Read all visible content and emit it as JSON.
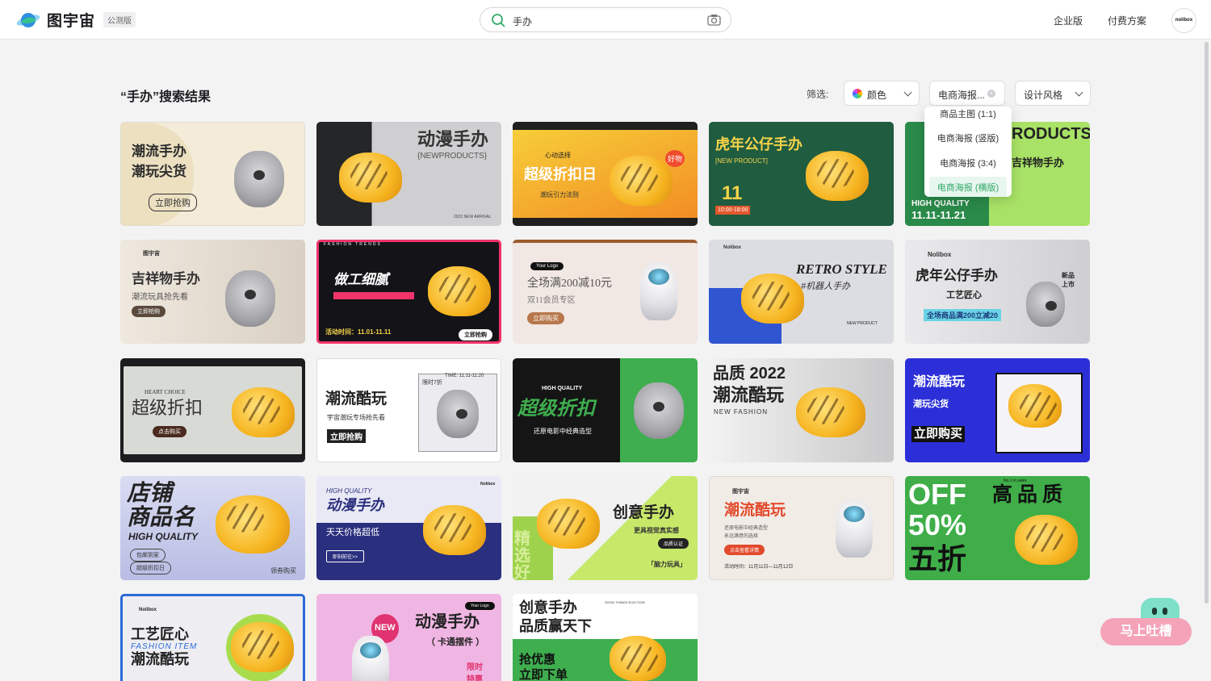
{
  "header": {
    "logo_text": "图宇宙",
    "beta_badge": "公测版",
    "search_value": "手办",
    "nav_enterprise": "企业版",
    "nav_pricing": "付费方案",
    "avatar_text": "nolibox"
  },
  "toolbar": {
    "results_title": "“手办”搜索结果",
    "filter_label": "筛选:",
    "color_filter": "颜色",
    "size_filter": "电商海报...",
    "style_filter": "设计风格"
  },
  "size_dropdown": {
    "options": [
      "商品主图 (1:1)",
      "电商海报 (竖版)",
      "电商海报 (3:4)",
      "电商海报 (横版)"
    ]
  },
  "cards": [
    {
      "title": "潮流手办",
      "title2": "潮玩尖货",
      "button": "立即抢购"
    },
    {
      "title": "动漫手办",
      "sub": "{NEWPRODUCTS}",
      "sub2": "2022 NEW ARRIVAL"
    },
    {
      "title": "超级折扣日",
      "sub": "潮玩引力法则",
      "badge": "心动选择",
      "chip": "好物"
    },
    {
      "title": "虎年公仔手办",
      "sub": "[NEW PRODUCT]",
      "num": "11",
      "time": "10:00-18:00"
    },
    {
      "title": "RODUCTS",
      "sub": "吉祥物手办",
      "sub2": "HIGH QUALITY",
      "sub3": "11.11-11.21"
    },
    {
      "title": "吉祥物手办",
      "sub": "潮流玩具抢先看",
      "button": "立即抢购",
      "brand": "图宇宙"
    },
    {
      "title": "做工细腻",
      "sub": "活动时间：11.01-11.11",
      "button": "立即抢购",
      "top": "FASHION TRENDS"
    },
    {
      "title": "全场满200减10元",
      "sub": "双11会员专区",
      "button": "立即购买",
      "logo": "Your Logo"
    },
    {
      "title": "RETRO STYLE",
      "sub": "#机器人手办",
      "sub2": "NEW PRODUCT",
      "brand": "Nolibox"
    },
    {
      "title": "虎年公仔手办",
      "sub": "工艺匠心",
      "sub2": "全场商品满200立减20",
      "tag": "新品上市",
      "brand": "Nolibox"
    },
    {
      "title": "超级折扣",
      "sub": "HEART CHOICE",
      "button": "点击购买"
    },
    {
      "title": "潮流酷玩",
      "sub": "宇宙潮玩专场抢先看",
      "button": "立即抢购",
      "tag": "限时7折",
      "time": "TIME: 11.11-11.20"
    },
    {
      "title": "超级折扣",
      "sub": "HIGH QUALITY",
      "sub2": "还原电影中经典造型"
    },
    {
      "title": "品质 2022",
      "title2": "潮流酷玩",
      "sub": "NEW FASHION"
    },
    {
      "title": "潮流酷玩",
      "sub": "潮玩尖货",
      "button": "立即购买"
    },
    {
      "title": "店铺",
      "title2": "商品名",
      "sub": "HIGH QUALITY",
      "b1": "包邮到家",
      "b2": "超级折扣日",
      "tag": "领券购买"
    },
    {
      "title": "动漫手办",
      "sub": "HIGH QUALITY",
      "sub2": "天天价格超低",
      "button": "即刻前往>>",
      "brand": "Nolibox"
    },
    {
      "title": "创意手办",
      "sub": "更具视觉真实感",
      "button": "品质认证",
      "sub2": "「脑力玩具」",
      "side": "精选好物"
    },
    {
      "title": "潮流酷玩",
      "sub": "还原电影中经典造型",
      "sub2": "永远满意的选择",
      "button": "点击查看详情",
      "time": "活动时间：11月11日—11月12日",
      "brand": "图宇宙"
    },
    {
      "title": "OFF",
      "big": "50%",
      "title2": "五折",
      "side": "高品质",
      "top": "No.1 in sales"
    },
    {
      "title": "工艺匠心",
      "sub": "FASHION ITEM",
      "title2": "潮流酷玩",
      "brand": "Nolibox"
    },
    {
      "title": "动漫手办",
      "sub": "（ 卡通摆件 ）",
      "chip": "NEW",
      "tag": "限时特惠",
      "logo": "Your Logo"
    },
    {
      "title": "创意手办",
      "title2": "品质赢天下",
      "sub": "抢优惠",
      "sub2": "立即下单",
      "top": "GOOD THINGS ELECTION"
    }
  ],
  "feedback": {
    "label": "马上吐槽"
  },
  "colors": {
    "accent": "#33a96a",
    "brand_blue": "#2a7cd9",
    "feedback_pink": "#f4a3b8"
  }
}
